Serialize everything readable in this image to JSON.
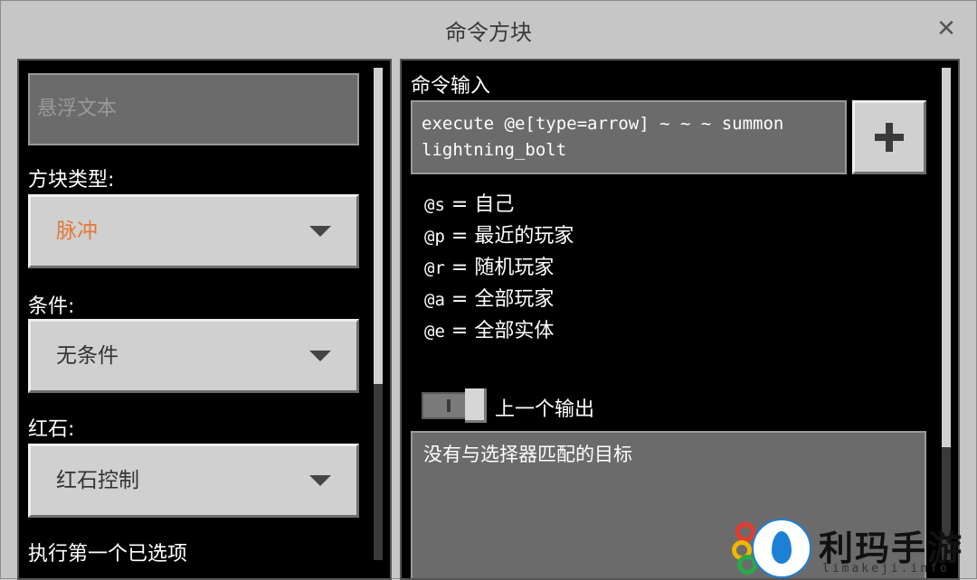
{
  "window": {
    "title": "命令方块",
    "close_glyph": "✕"
  },
  "left_panel": {
    "hover_text_placeholder": "悬浮文本",
    "block_type_label": "方块类型:",
    "block_type_value": "脉冲",
    "block_type_value_color": "#e07a3a",
    "condition_label": "条件:",
    "condition_value": "无条件",
    "redstone_label": "红石:",
    "redstone_value": "红石控制",
    "execute_first_label": "执行第一个已选项"
  },
  "right_panel": {
    "command_input_label": "命令输入",
    "command_line1": "execute @e[type=arrow] ~ ~ ~ summon",
    "command_line2": "lightning_bolt",
    "add_button_icon": "plus-icon",
    "selectors": [
      {
        "code": "@s",
        "eq": "=",
        "desc": "自己"
      },
      {
        "code": "@p",
        "eq": "=",
        "desc": "最近的玩家"
      },
      {
        "code": "@r",
        "eq": "=",
        "desc": "随机玩家"
      },
      {
        "code": "@a",
        "eq": "=",
        "desc": "全部玩家"
      },
      {
        "code": "@e",
        "eq": "=",
        "desc": "全部实体"
      }
    ],
    "previous_output_label": "上一个输出",
    "previous_output_toggle_on": false,
    "output_text": "没有与选择器匹配的目标"
  },
  "watermark": {
    "name": "利玛手游",
    "url": "limakeji.info"
  }
}
